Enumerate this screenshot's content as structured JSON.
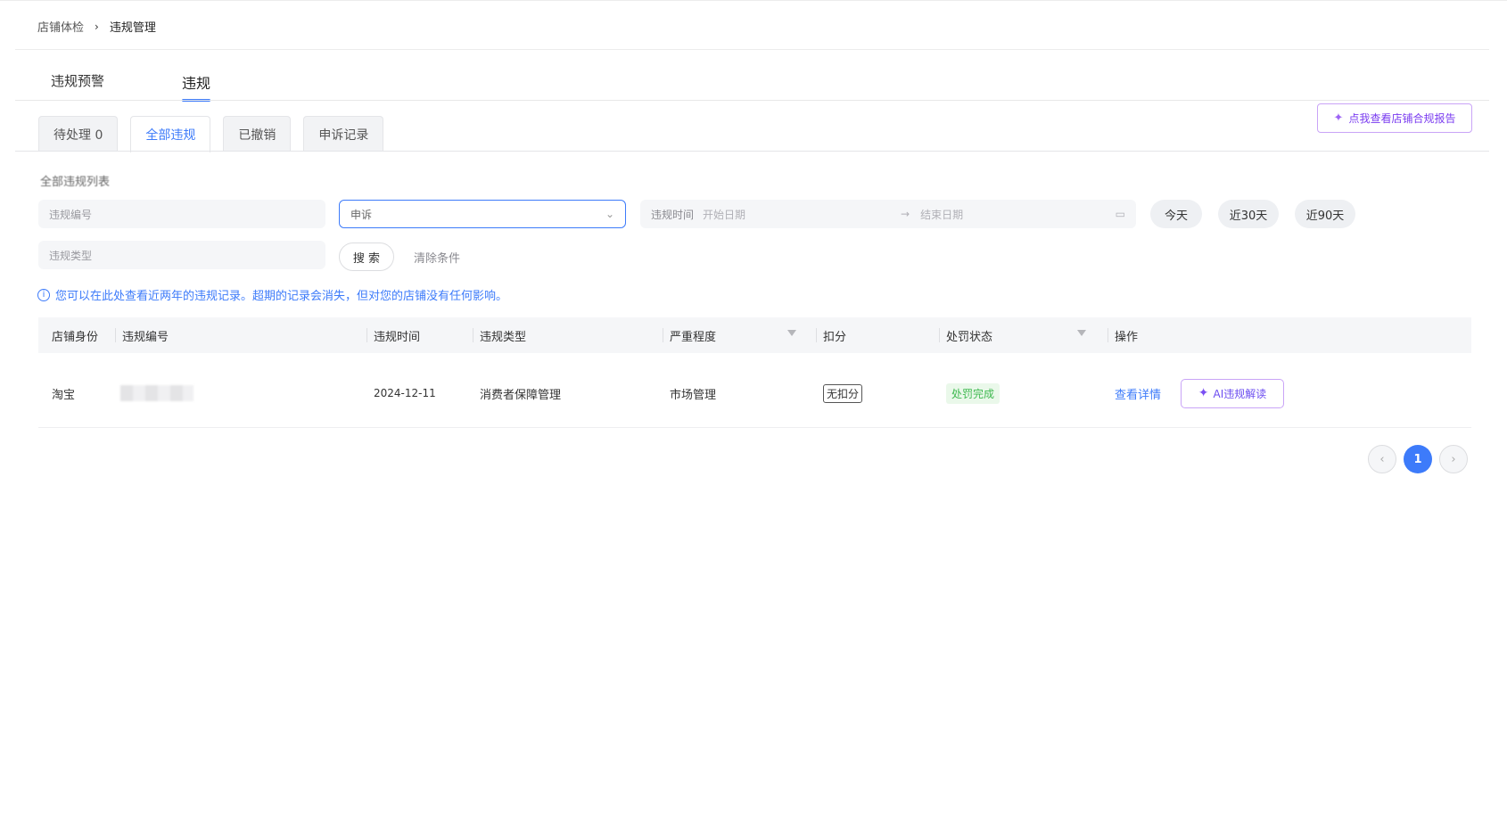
{
  "breadcrumb": {
    "parent": "店铺体检",
    "separator": "›",
    "current": "违规管理"
  },
  "main_tabs": [
    "违规预警",
    "违规"
  ],
  "report_button": {
    "icon": "sparkle-icon",
    "label": "点我查看店铺合规报告"
  },
  "sub_tabs": [
    "待处理 0",
    "全部违规",
    "已撤销",
    "申诉记录"
  ],
  "section_title": "全部违规列表",
  "filters": {
    "violation_id_placeholder": "违规编号",
    "appeal_select_value": "申诉",
    "date_label": "违规时间",
    "start_date_placeholder": "开始日期",
    "date_arrow": "→",
    "end_date_placeholder": "结束日期",
    "violation_type_placeholder": "违规类型",
    "quick_today": "今天",
    "quick_30": "近30天",
    "quick_90": "近90天",
    "search": "搜 索",
    "clear": "清除条件"
  },
  "notice": "您可以在此处查看近两年的违规记录。超期的记录会消失，但对您的店铺没有任何影响。",
  "table": {
    "headers": [
      "店铺身份",
      "违规编号",
      "违规时间",
      "违规类型",
      "严重程度",
      "扣分",
      "处罚状态",
      "操作"
    ],
    "rows": [
      {
        "identity": "淘宝",
        "violation_id": "",
        "time": "2024-12-11",
        "type": "消费者保障管理",
        "severity": "市场管理",
        "deduction": "无扣分",
        "status": "处罚完成",
        "action_detail": "查看详情",
        "action_ai": "AI违规解读"
      }
    ]
  },
  "pagination": {
    "prev": "‹",
    "current": "1",
    "next": "›"
  },
  "colors": {
    "accent": "#3d7bfa",
    "ai_purple": "#7a3cf0",
    "success": "#3fb950"
  }
}
